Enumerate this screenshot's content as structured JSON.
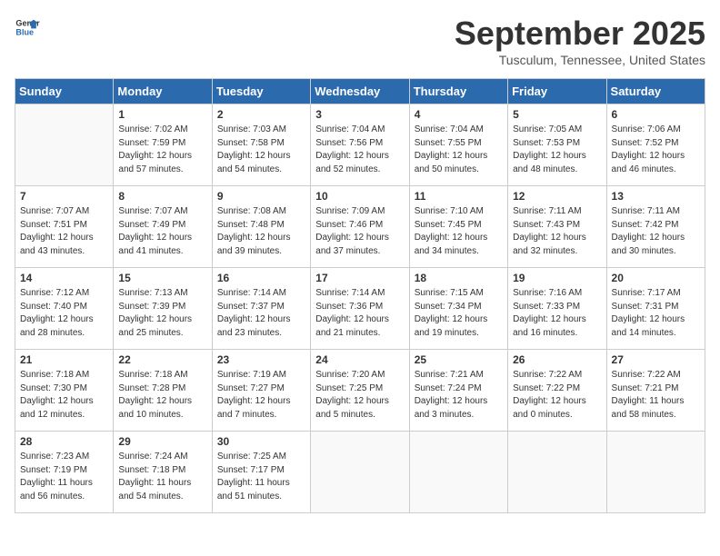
{
  "logo": {
    "general": "General",
    "blue": "Blue"
  },
  "title": "September 2025",
  "location": "Tusculum, Tennessee, United States",
  "days_of_week": [
    "Sunday",
    "Monday",
    "Tuesday",
    "Wednesday",
    "Thursday",
    "Friday",
    "Saturday"
  ],
  "weeks": [
    [
      {
        "day": "",
        "info": ""
      },
      {
        "day": "1",
        "info": "Sunrise: 7:02 AM\nSunset: 7:59 PM\nDaylight: 12 hours\nand 57 minutes."
      },
      {
        "day": "2",
        "info": "Sunrise: 7:03 AM\nSunset: 7:58 PM\nDaylight: 12 hours\nand 54 minutes."
      },
      {
        "day": "3",
        "info": "Sunrise: 7:04 AM\nSunset: 7:56 PM\nDaylight: 12 hours\nand 52 minutes."
      },
      {
        "day": "4",
        "info": "Sunrise: 7:04 AM\nSunset: 7:55 PM\nDaylight: 12 hours\nand 50 minutes."
      },
      {
        "day": "5",
        "info": "Sunrise: 7:05 AM\nSunset: 7:53 PM\nDaylight: 12 hours\nand 48 minutes."
      },
      {
        "day": "6",
        "info": "Sunrise: 7:06 AM\nSunset: 7:52 PM\nDaylight: 12 hours\nand 46 minutes."
      }
    ],
    [
      {
        "day": "7",
        "info": "Sunrise: 7:07 AM\nSunset: 7:51 PM\nDaylight: 12 hours\nand 43 minutes."
      },
      {
        "day": "8",
        "info": "Sunrise: 7:07 AM\nSunset: 7:49 PM\nDaylight: 12 hours\nand 41 minutes."
      },
      {
        "day": "9",
        "info": "Sunrise: 7:08 AM\nSunset: 7:48 PM\nDaylight: 12 hours\nand 39 minutes."
      },
      {
        "day": "10",
        "info": "Sunrise: 7:09 AM\nSunset: 7:46 PM\nDaylight: 12 hours\nand 37 minutes."
      },
      {
        "day": "11",
        "info": "Sunrise: 7:10 AM\nSunset: 7:45 PM\nDaylight: 12 hours\nand 34 minutes."
      },
      {
        "day": "12",
        "info": "Sunrise: 7:11 AM\nSunset: 7:43 PM\nDaylight: 12 hours\nand 32 minutes."
      },
      {
        "day": "13",
        "info": "Sunrise: 7:11 AM\nSunset: 7:42 PM\nDaylight: 12 hours\nand 30 minutes."
      }
    ],
    [
      {
        "day": "14",
        "info": "Sunrise: 7:12 AM\nSunset: 7:40 PM\nDaylight: 12 hours\nand 28 minutes."
      },
      {
        "day": "15",
        "info": "Sunrise: 7:13 AM\nSunset: 7:39 PM\nDaylight: 12 hours\nand 25 minutes."
      },
      {
        "day": "16",
        "info": "Sunrise: 7:14 AM\nSunset: 7:37 PM\nDaylight: 12 hours\nand 23 minutes."
      },
      {
        "day": "17",
        "info": "Sunrise: 7:14 AM\nSunset: 7:36 PM\nDaylight: 12 hours\nand 21 minutes."
      },
      {
        "day": "18",
        "info": "Sunrise: 7:15 AM\nSunset: 7:34 PM\nDaylight: 12 hours\nand 19 minutes."
      },
      {
        "day": "19",
        "info": "Sunrise: 7:16 AM\nSunset: 7:33 PM\nDaylight: 12 hours\nand 16 minutes."
      },
      {
        "day": "20",
        "info": "Sunrise: 7:17 AM\nSunset: 7:31 PM\nDaylight: 12 hours\nand 14 minutes."
      }
    ],
    [
      {
        "day": "21",
        "info": "Sunrise: 7:18 AM\nSunset: 7:30 PM\nDaylight: 12 hours\nand 12 minutes."
      },
      {
        "day": "22",
        "info": "Sunrise: 7:18 AM\nSunset: 7:28 PM\nDaylight: 12 hours\nand 10 minutes."
      },
      {
        "day": "23",
        "info": "Sunrise: 7:19 AM\nSunset: 7:27 PM\nDaylight: 12 hours\nand 7 minutes."
      },
      {
        "day": "24",
        "info": "Sunrise: 7:20 AM\nSunset: 7:25 PM\nDaylight: 12 hours\nand 5 minutes."
      },
      {
        "day": "25",
        "info": "Sunrise: 7:21 AM\nSunset: 7:24 PM\nDaylight: 12 hours\nand 3 minutes."
      },
      {
        "day": "26",
        "info": "Sunrise: 7:22 AM\nSunset: 7:22 PM\nDaylight: 12 hours\nand 0 minutes."
      },
      {
        "day": "27",
        "info": "Sunrise: 7:22 AM\nSunset: 7:21 PM\nDaylight: 11 hours\nand 58 minutes."
      }
    ],
    [
      {
        "day": "28",
        "info": "Sunrise: 7:23 AM\nSunset: 7:19 PM\nDaylight: 11 hours\nand 56 minutes."
      },
      {
        "day": "29",
        "info": "Sunrise: 7:24 AM\nSunset: 7:18 PM\nDaylight: 11 hours\nand 54 minutes."
      },
      {
        "day": "30",
        "info": "Sunrise: 7:25 AM\nSunset: 7:17 PM\nDaylight: 11 hours\nand 51 minutes."
      },
      {
        "day": "",
        "info": ""
      },
      {
        "day": "",
        "info": ""
      },
      {
        "day": "",
        "info": ""
      },
      {
        "day": "",
        "info": ""
      }
    ]
  ]
}
